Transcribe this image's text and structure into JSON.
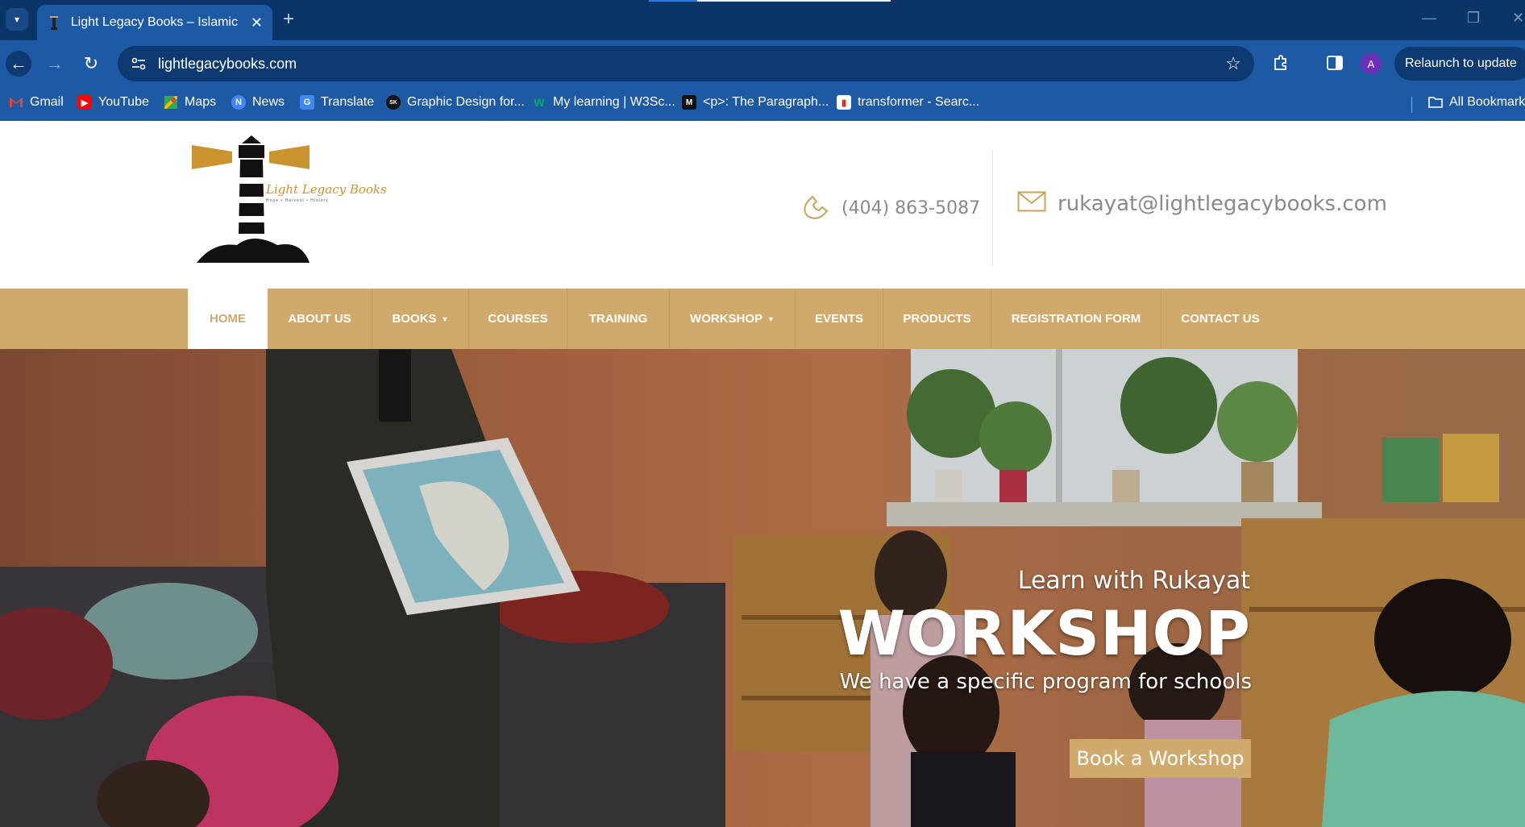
{
  "browser": {
    "tab_title": "Light Legacy Books – Islamic Te",
    "url": "lightlegacybooks.com",
    "profile_initial": "A",
    "relaunch_label": "Relaunch to update",
    "bookmarks": [
      "Gmail",
      "YouTube",
      "Maps",
      "News",
      "Translate",
      "Graphic Design for...",
      "My learning | W3Sc...",
      "<p>: The Paragraph...",
      "transformer - Searc..."
    ],
    "all_bookmarks_label": "All Bookmarks"
  },
  "site": {
    "logo_text": "Light Legacy Books",
    "logo_tagline": "Hope • Harvest • History",
    "phone": "(404) 863-5087",
    "email": "rukayat@lightlegacybooks.com",
    "accent_color": "#d0aa6c",
    "menu": [
      {
        "label": "HOME",
        "active": true
      },
      {
        "label": "ABOUT US"
      },
      {
        "label": "BOOKS",
        "dropdown": true
      },
      {
        "label": "COURSES"
      },
      {
        "label": "TRAINING"
      },
      {
        "label": "WORKSHOP",
        "dropdown": true
      },
      {
        "label": "EVENTS"
      },
      {
        "label": "PRODUCTS"
      },
      {
        "label": "REGISTRATION FORM"
      },
      {
        "label": "CONTACT US"
      }
    ]
  },
  "hero": {
    "subtitle": "Learn with Rukayat",
    "title": "WORKSHOP",
    "description": "We have a specific program for schools",
    "button_label": "Book a Workshop"
  }
}
